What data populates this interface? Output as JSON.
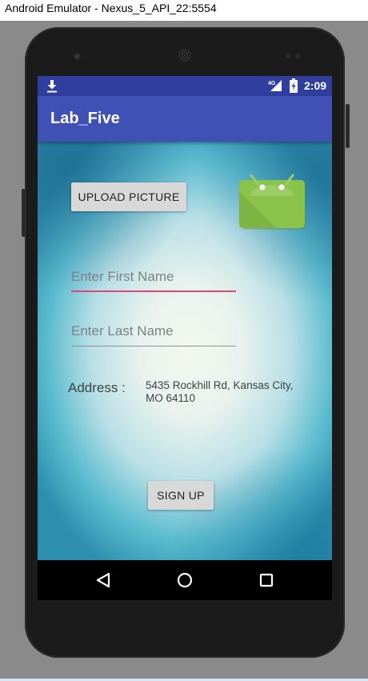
{
  "window": {
    "title": "Android Emulator - Nexus_5_API_22:5554"
  },
  "status_bar": {
    "notification_icon": "download-icon",
    "network_label": "4G",
    "signal_icon": "cell-signal-icon",
    "battery_icon": "battery-charging-icon",
    "time": "2:09"
  },
  "app_bar": {
    "title": "Lab_Five"
  },
  "form": {
    "upload_button_label": "UPLOAD PICTURE",
    "image_icon": "android-robot-icon",
    "first_name_placeholder": "Enter First Name",
    "first_name_value": "",
    "last_name_placeholder": "Enter Last Name",
    "last_name_value": "",
    "address_label": "Address :",
    "address_value": "5435 Rockhill Rd, Kansas City, MO 64110",
    "signup_button_label": "SIGN UP"
  },
  "nav_bar": {
    "back_icon": "back-triangle-icon",
    "home_icon": "home-circle-icon",
    "recents_icon": "recents-square-icon"
  },
  "colors": {
    "primary": "#3f51b5",
    "primary_dark": "#303f9f",
    "accent": "#e0457a",
    "android_green": "#8bc34a"
  }
}
